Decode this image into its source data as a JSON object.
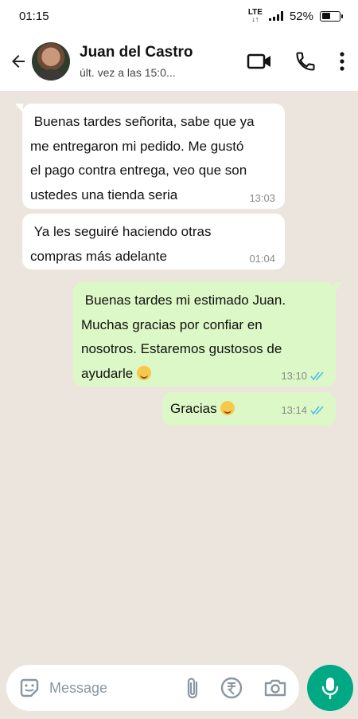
{
  "status_bar": {
    "time": "01:15",
    "network": "LTE",
    "battery": "52%",
    "battery_level": 0.52
  },
  "header": {
    "contact_name": "Juan del Castro",
    "last_seen": "últ. vez a las 15:0..."
  },
  "messages": [
    {
      "direction": "in",
      "text": " Buenas tardes señorita, sabe que ya\nme entregaron mi pedido. Me gustó\nel pago contra entrega, veo que son\nustedes una tienda seria",
      "time": "13:03"
    },
    {
      "direction": "in",
      "text": " Ya les seguiré haciendo otras\ncompras más adelante",
      "time": "01:04"
    },
    {
      "direction": "out",
      "text": " Buenas tardes mi estimado Juan.\nMuchas gracias por confiar en\nnosotros. Estaremos gustosos de\nayudarle",
      "time": "13:10",
      "emoji": "smiling-face"
    },
    {
      "direction": "out",
      "text": "Gracias",
      "time": "13:14",
      "emoji": "smiling-face"
    }
  ],
  "input": {
    "placeholder": "Message"
  },
  "colors": {
    "accent": "#00a884",
    "outgoing_bubble": "#dcf8c6",
    "read_ticks": "#53bdeb"
  }
}
